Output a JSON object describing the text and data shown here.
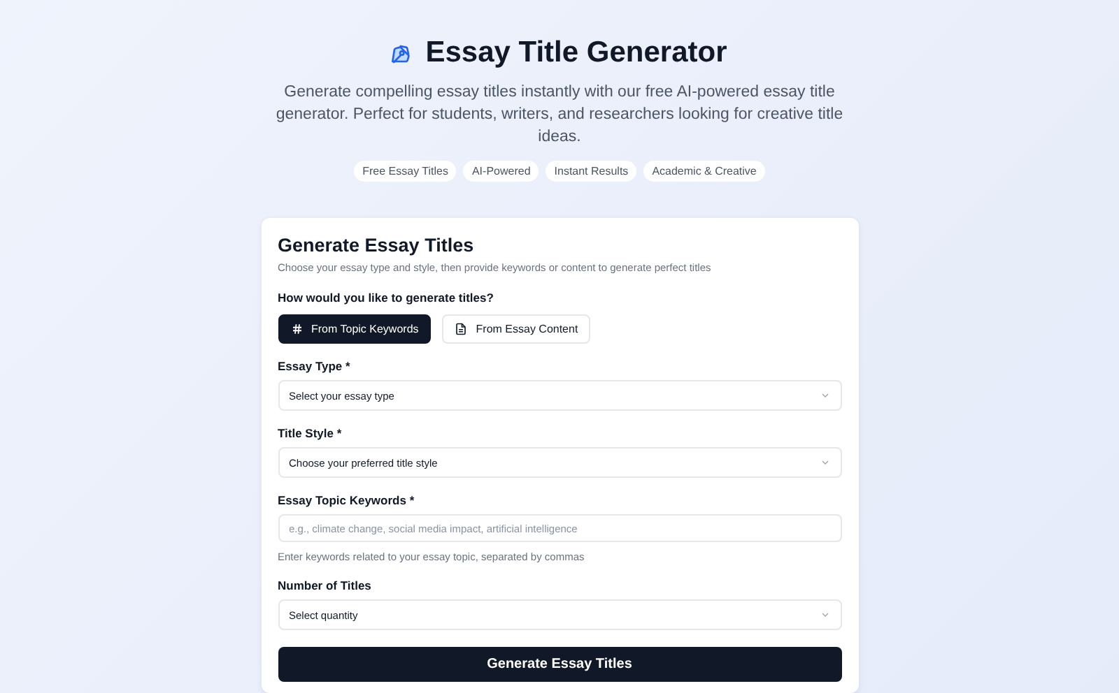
{
  "header": {
    "title": "Essay Title Generator",
    "subtitle": "Generate compelling essay titles instantly with our free AI-powered essay title generator. Perfect for students, writers, and researchers looking for creative title ideas.",
    "tags": [
      "Free Essay Titles",
      "AI-Powered",
      "Instant Results",
      "Academic & Creative"
    ]
  },
  "card": {
    "title": "Generate Essay Titles",
    "description": "Choose your essay type and style, then provide keywords or content to generate perfect titles",
    "mode_question": "How would you like to generate titles?",
    "modes": [
      {
        "label": "From Topic Keywords",
        "kind": "hash",
        "selected": true
      },
      {
        "label": "From Essay Content",
        "kind": "document",
        "selected": false
      }
    ],
    "fields": [
      {
        "kind": "select",
        "label": "Essay Type *",
        "placeholder": "Select your essay type"
      },
      {
        "kind": "select",
        "label": "Title Style *",
        "placeholder": "Choose your preferred title style"
      },
      {
        "kind": "text",
        "label": "Essay Topic Keywords *",
        "placeholder": "e.g., climate change, social media impact, artificial intelligence",
        "hint": "Enter keywords related to your essay topic, separated by commas"
      },
      {
        "kind": "select",
        "label": "Number of Titles",
        "placeholder": "Select quantity"
      }
    ],
    "submit": "Generate Essay Titles"
  }
}
